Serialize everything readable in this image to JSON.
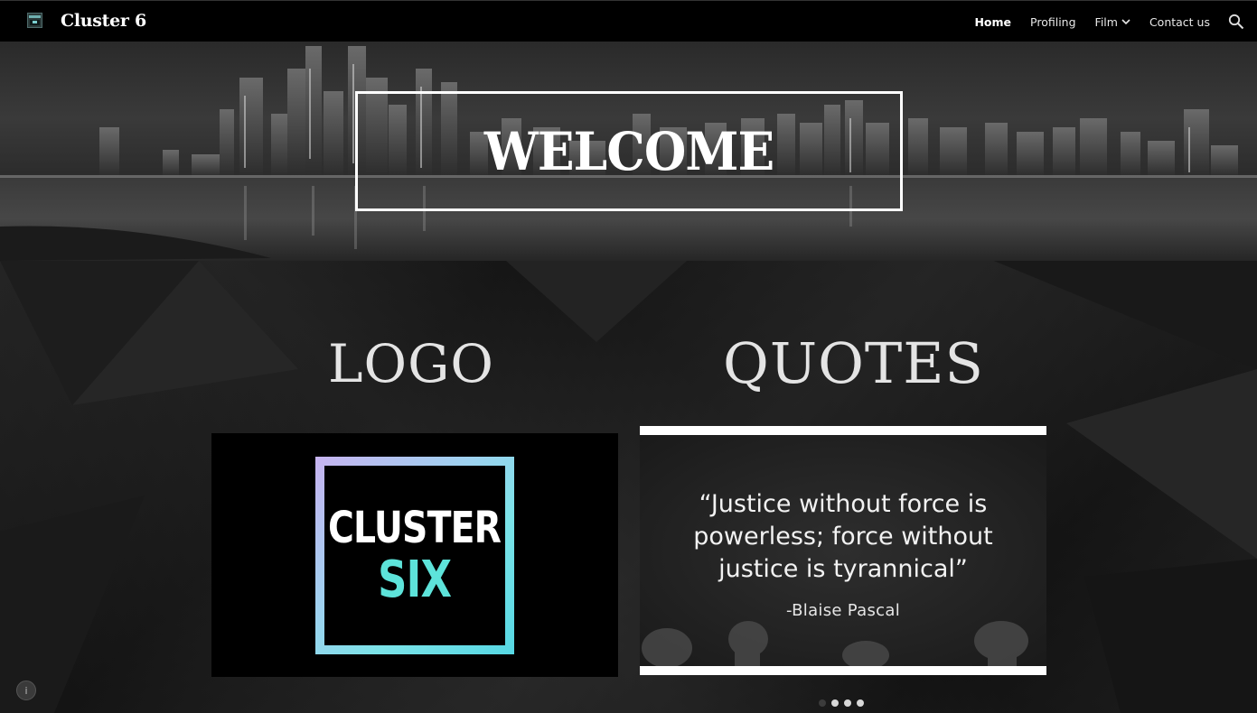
{
  "header": {
    "site_title": "Cluster 6",
    "site_icon": "site-logo-icon",
    "nav": [
      {
        "label": "Home",
        "active": true
      },
      {
        "label": "Profiling",
        "active": false
      },
      {
        "label": "Film",
        "active": false,
        "has_dropdown": true
      },
      {
        "label": "Contact us",
        "active": false
      }
    ],
    "search_icon": "search-icon"
  },
  "hero": {
    "title": "WELCOME"
  },
  "sections": {
    "logo_heading": "LOGO",
    "quotes_heading": "QUOTES",
    "logo_image": {
      "line1": "CLUSTER",
      "line2": "SIX"
    },
    "quote": {
      "lines": [
        "“Justice without force is",
        "powerless; force without",
        "justice is tyrannical”"
      ],
      "author": "-Blaise Pascal"
    },
    "carousel": {
      "count": 4,
      "active": 1
    }
  },
  "footer": {
    "info_icon": "info-icon",
    "info_glyph": "i"
  },
  "colors": {
    "accent_teal": "#5de3da",
    "background": "#0b0b0b"
  }
}
